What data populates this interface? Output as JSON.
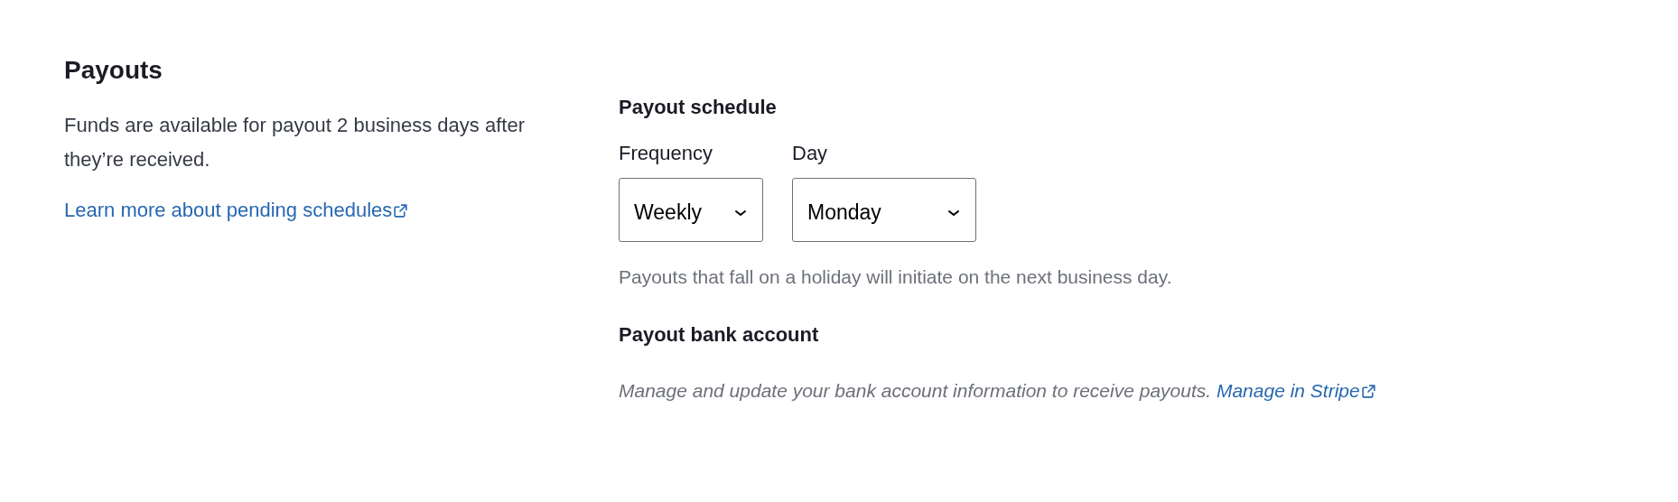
{
  "section": {
    "title": "Payouts",
    "description": "Funds are available for payout 2 business days after they’re received.",
    "link": "Learn more about pending schedules"
  },
  "schedule": {
    "heading": "Payout schedule",
    "fields": [
      {
        "label": "Frequency",
        "value": "Weekly"
      },
      {
        "label": "Day",
        "value": "Monday"
      }
    ],
    "hint": "Payouts that fall on a holiday will initiate on the next business day."
  },
  "bank_account": {
    "heading": "Payout bank account",
    "text": "Manage and update your bank account information to receive payouts.",
    "link": "Manage in Stripe"
  }
}
